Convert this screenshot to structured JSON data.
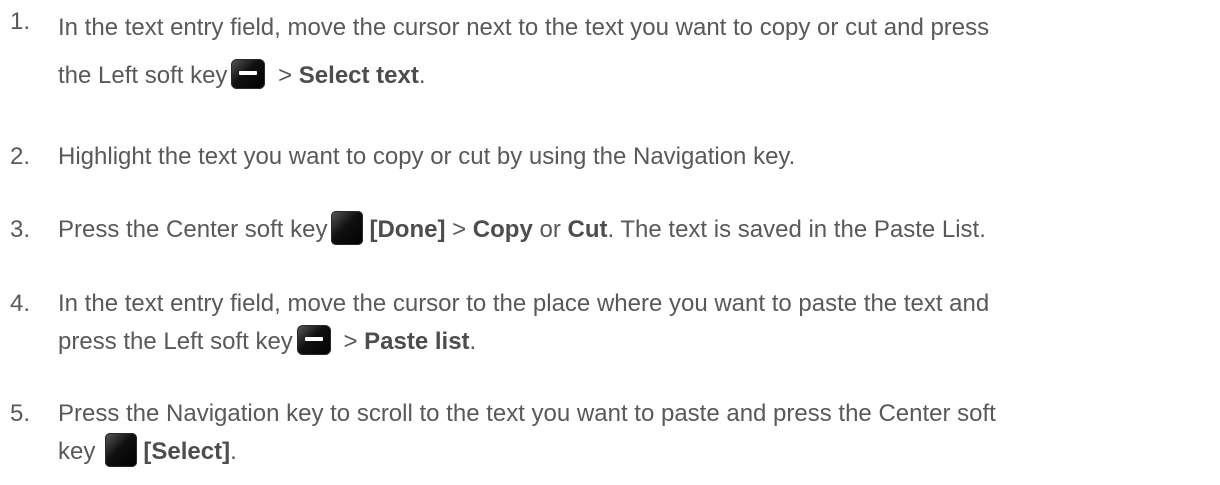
{
  "steps": [
    {
      "number": "1.",
      "line1": "In the text entry field, move the cursor next to the text you want to copy or cut and press",
      "line2_pre": "the Left soft key",
      "line2_mid": " > ",
      "line2_bold": "Select text",
      "line2_post": "."
    },
    {
      "number": "2.",
      "text": "Highlight the text you want to copy or cut by using the Navigation key."
    },
    {
      "number": "3.",
      "pre": "Press the Center soft key",
      "bold1": "[Done]",
      "mid1": " > ",
      "bold2": "Copy",
      "mid2": " or ",
      "bold3": "Cut",
      "post": ". The text is saved in the Paste List."
    },
    {
      "number": "4.",
      "line1": "In the text entry field, move the cursor to the place where you want to paste the text and",
      "line2_pre": "press the Left soft key",
      "line2_mid": " > ",
      "line2_bold": "Paste list",
      "line2_post": "."
    },
    {
      "number": "5.",
      "line1": "Press the Navigation key to scroll to the text you want to paste and press the Center soft",
      "line2_pre": "key",
      "line2_bold": "[Select]",
      "line2_post": "."
    }
  ],
  "icons": {
    "left_soft_key": "left-soft-key-icon",
    "center_soft_key": "center-soft-key-icon"
  }
}
